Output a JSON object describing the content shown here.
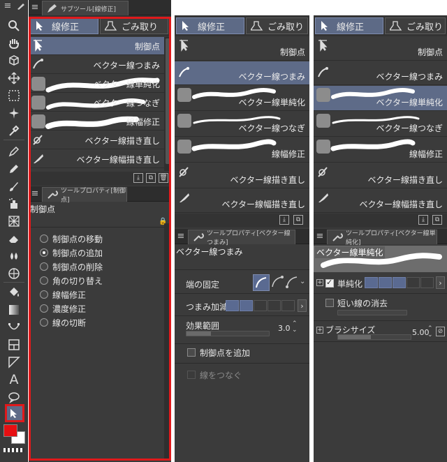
{
  "colors": {
    "accent": "#5e6b88",
    "highlight_frame": "#e0191b",
    "fg_color": "#e60f12",
    "bg_color": "#ffffff"
  },
  "toolbar": {
    "tools": [
      "zoom-icon",
      "hand-icon",
      "object-icon",
      "move-icon",
      "selection-icon",
      "magic-wand-icon",
      "eyedropper-icon",
      "pen-icon",
      "pencil-icon",
      "brush-icon",
      "airbrush-icon",
      "decoration-icon",
      "eraser-icon",
      "blend-icon",
      "figure-icon",
      "fill-icon",
      "gradient-icon",
      "line-icon",
      "frame-icon",
      "ruler-icon",
      "text-icon",
      "balloon-icon",
      "correct-line-icon"
    ]
  },
  "panel1": {
    "sub_tool_tab": "サブツール[線修正]",
    "group_fix": "線修正",
    "group_dust": "ごみ取り",
    "subtools": [
      "制御点",
      "ベクター線つまみ",
      "ベクター線単純化",
      "ベクター線つなぎ",
      "線幅修正",
      "ベクター線描き直し",
      "ベクター線幅描き直し"
    ],
    "prop_tab": "ツールプロパティ[制御点]",
    "prop_title": "制御点",
    "options": [
      "制御点の移動",
      "制御点の追加",
      "制御点の削除",
      "角の切り替え",
      "線幅修正",
      "濃度修正",
      "線の切断"
    ],
    "selected_option": 1
  },
  "panel2": {
    "group_fix": "線修正",
    "group_dust": "ごみ取り",
    "subtools": [
      "制御点",
      "ベクター線つまみ",
      "ベクター線単純化",
      "ベクター線つなぎ",
      "線幅修正",
      "ベクター線描き直し",
      "ベクター線幅描き直し"
    ],
    "prop_tab": "ツールプロパティ[ベクター線つまみ]",
    "prop_title": "ベクター線つまみ",
    "end_fix_label": "端の固定",
    "pinch_label": "つまみ加減",
    "range_label": "効果範囲",
    "range_value": "3.0",
    "range_fraction": 0.3,
    "add_point_label": "制御点を追加",
    "join_label": "線をつなぐ"
  },
  "panel3": {
    "group_fix": "線修正",
    "group_dust": "ごみ取り",
    "subtools": [
      "制御点",
      "ベクター線つまみ",
      "ベクター線単純化",
      "ベクター線つなぎ",
      "線幅修正",
      "ベクター線描き直し",
      "ベクター線幅描き直し"
    ],
    "prop_tab": "ツールプロパティ[ベクター線単純化]",
    "prop_title": "ベクター線単純化",
    "simplify_label": "単純化",
    "short_erase_label": "短い線の消去",
    "brush_size_label": "ブラシサイズ",
    "brush_size_value": "5.00",
    "brush_size_fraction": 0.45
  }
}
